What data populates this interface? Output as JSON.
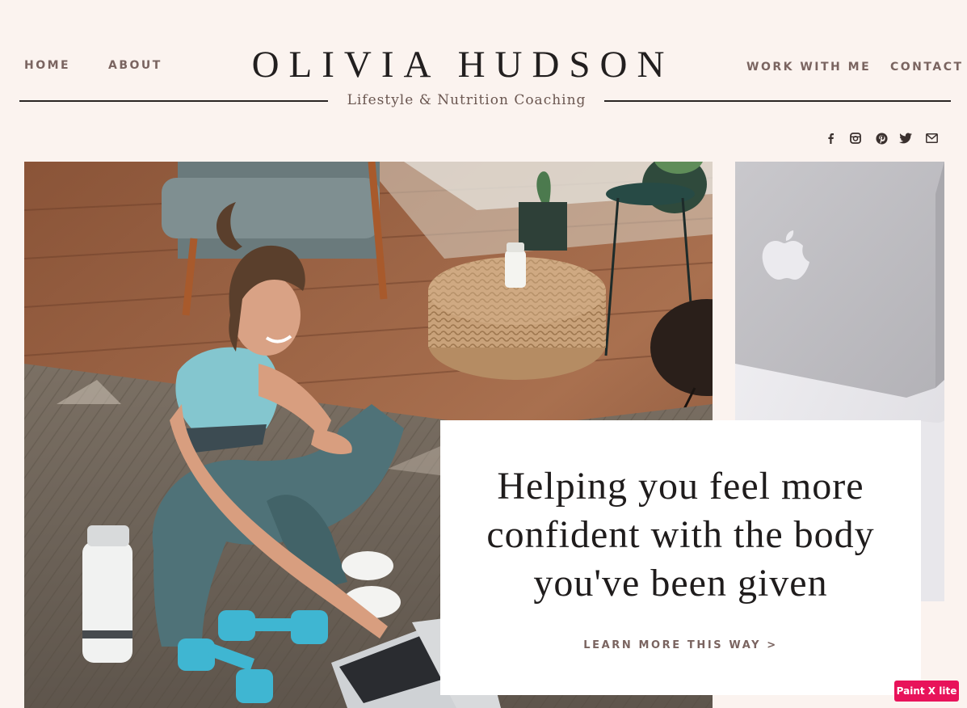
{
  "nav": {
    "home": "HOME",
    "about": "ABOUT",
    "work_with_me": "WORK WITH ME",
    "contact": "CONTACT"
  },
  "brand": {
    "name": "OLIVIA HUDSON",
    "tagline": "Lifestyle & Nutrition Coaching"
  },
  "social": [
    "facebook-icon",
    "instagram-icon",
    "pinterest-icon",
    "twitter-icon",
    "email-icon"
  ],
  "hero": {
    "headline": "Helping you feel more confident with the body you've been given",
    "cta": "LEARN MORE THIS WAY >"
  },
  "badge": "Paint X lite",
  "colors": {
    "background": "#fbf3ef",
    "accent_text": "#7a6460",
    "dark_text": "#221f1f",
    "card": "#ffffff",
    "badge": "#e8135a"
  }
}
